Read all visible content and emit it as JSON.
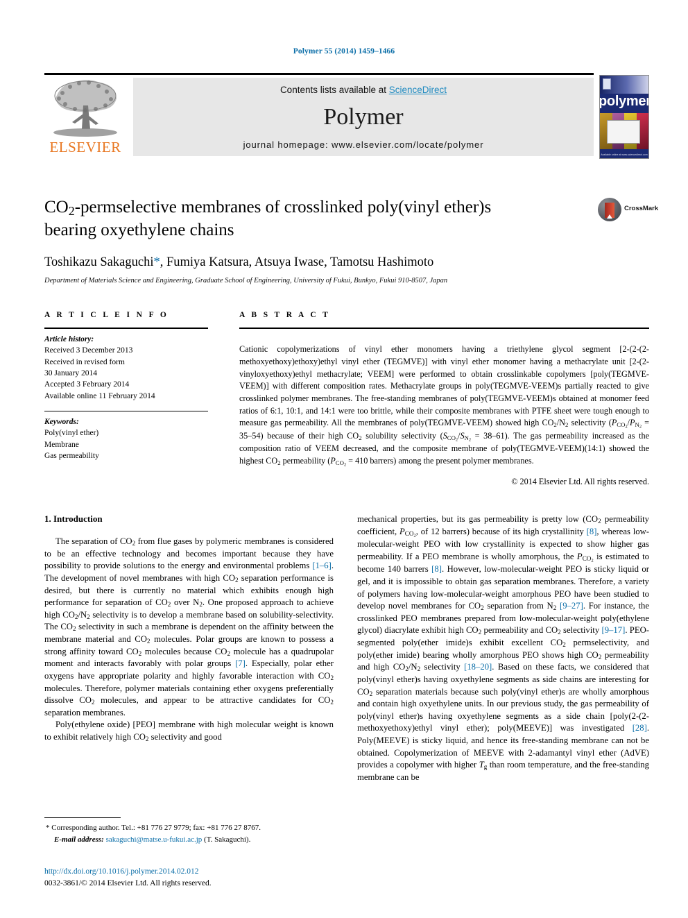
{
  "running_head": "Polymer 55 (2014) 1459–1466",
  "header": {
    "contents_prefix": "Contents lists available at ",
    "sciencedirect": "ScienceDirect",
    "journal_name": "Polymer",
    "homepage": "journal homepage: www.elsevier.com/locate/polymer",
    "publisher_logo_text": "ELSEVIER",
    "cover_word": "polymer",
    "cover_footer": "Available online at www.sciencedirect.com"
  },
  "article": {
    "title_line1": "CO2-permselective membranes of crosslinked poly(vinyl ether)s",
    "title_line2": "bearing oxyethylene chains",
    "authors": "Toshikazu Sakaguchi*, Fumiya Katsura, Atsuya Iwase, Tamotsu Hashimoto",
    "affiliation": "Department of Materials Science and Engineering, Graduate School of Engineering, University of Fukui, Bunkyo, Fukui 910-8507, Japan",
    "crossmark_label": "CrossMark"
  },
  "article_info": {
    "heading": "A R T I C L E   I N F O",
    "history_label": "Article history:",
    "history": [
      "Received 3 December 2013",
      "Received in revised form",
      "30 January 2014",
      "Accepted 3 February 2014",
      "Available online 11 February 2014"
    ],
    "keywords_label": "Keywords:",
    "keywords": [
      "Poly(vinyl ether)",
      "Membrane",
      "Gas permeability"
    ]
  },
  "abstract": {
    "heading": "A B S T R A C T",
    "body": "Cationic copolymerizations of vinyl ether monomers having a triethylene glycol segment [2-(2-(2-methoxyethoxy)ethoxy)ethyl vinyl ether (TEGMVE)] with vinyl ether monomer having a methacrylate unit [2-(2-vinyloxyethoxy)ethyl methacrylate; VEEM] were performed to obtain crosslinkable copolymers [poly(TEGMVE-VEEM)] with different composition rates. Methacrylate groups in poly(TEGMVE-VEEM)s partially reacted to give crosslinked polymer membranes. The free-standing membranes of poly(TEGMVE-VEEM)s obtained at monomer feed ratios of 6:1, 10:1, and 14:1 were too brittle, while their composite membranes with PTFE sheet were tough enough to measure gas permeability. All the membranes of poly(TEGMVE-VEEM) showed high CO2/N2 selectivity (PCO2/PN2 = 35–54) because of their high CO2 solubility selectivity (SCO2/SN2 = 38–61). The gas permeability increased as the composition ratio of VEEM decreased, and the composite membrane of poly(TEGMVE-VEEM)(14:1) showed the highest CO2 permeability (PCO2 = 410 barrers) among the present polymer membranes.",
    "copyright": "© 2014 Elsevier Ltd. All rights reserved."
  },
  "introduction": {
    "heading": "1. Introduction",
    "paragraph1": "The separation of CO2 from flue gases by polymeric membranes is considered to be an effective technology and becomes important because they have possibility to provide solutions to the energy and environmental problems [1–6]. The development of novel membranes with high CO2 separation performance is desired, but there is currently no material which exhibits enough high performance for separation of CO2 over N2. One proposed approach to achieve high CO2/N2 selectivity is to develop a membrane based on solubility-selectivity. The CO2 selectivity in such a membrane is dependent on the affinity between the membrane material and CO2 molecules. Polar groups are known to possess a strong affinity toward CO2 molecules because CO2 molecule has a quadrupolar moment and interacts favorably with polar groups [7]. Especially, polar ether oxygens have appropriate polarity and highly favorable interaction with CO2 molecules. Therefore, polymer materials containing ether oxygens preferentially dissolve CO2 molecules, and appear to be attractive candidates for CO2 separation membranes.",
    "paragraph2": "Poly(ethylene oxide) [PEO] membrane with high molecular weight is known to exhibit relatively high CO2 selectivity and good mechanical properties, but its gas permeability is pretty low (CO2 permeability coefficient, PCO2, of 12 barrers) because of its high crystallinity [8], whereas low-molecular-weight PEO with low crystallinity is expected to show higher gas permeability. If a PEO membrane is wholly amorphous, the PCO2 is estimated to become 140 barrers [8]. However, low-molecular-weight PEO is sticky liquid or gel, and it is impossible to obtain gas separation membranes. Therefore, a variety of polymers having low-molecular-weight amorphous PEO have been studied to develop novel membranes for CO2 separation from N2 [9–27]. For instance, the crosslinked PEO membranes prepared from low-molecular-weight poly(ethylene glycol) diacrylate exhibit high CO2 permeability and CO2 selectivity [9–17]. PEO-segmented poly(ether imide)s exhibit excellent CO2 permselectivity, and poly(ether imide) bearing wholly amorphous PEO shows high CO2 permeability and high CO2/N2 selectivity [18–20]. Based on these facts, we considered that poly(vinyl ether)s having oxyethylene segments as side chains are interesting for CO2 separation materials because such poly(vinyl ether)s are wholly amorphous and contain high oxyethylene units. In our previous study, the gas permeability of poly(vinyl ether)s having oxyethylene segments as a side chain [poly(2-(2-methoxyethoxy)ethyl vinyl ether); poly(MEEVE)] was investigated [28]. Poly(MEEVE) is sticky liquid, and hence its free-standing membrane can not be obtained. Copolymerization of MEEVE with 2-adamantyl vinyl ether (AdVE) provides a copolymer with higher Tg than room temperature, and the free-standing membrane can be"
  },
  "footnote": {
    "corresponding": "* Corresponding author. Tel.: +81 776 27 9779; fax: +81 776 27 8767.",
    "email_label": "E-mail address:",
    "email": "sakaguchi@matse.u-fukui.ac.jp",
    "email_suffix": "(T. Sakaguchi).",
    "doi": "http://dx.doi.org/10.1016/j.polymer.2014.02.012",
    "issn_line": "0032-3861/© 2014 Elsevier Ltd. All rights reserved."
  },
  "colors": {
    "link_blue": "#0b6ea8",
    "sciencedirect_blue": "#1f8ac0",
    "elsevier_orange": "#E87722",
    "band_grey": "#e7e7e7"
  }
}
